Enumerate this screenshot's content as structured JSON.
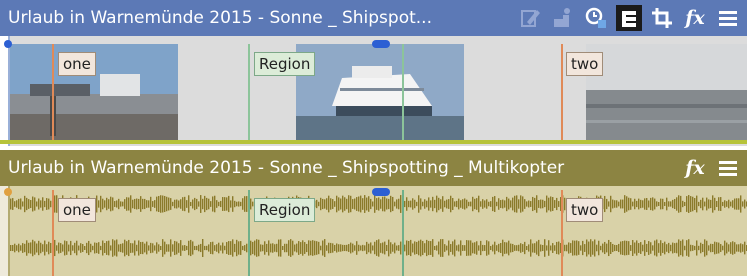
{
  "video_track": {
    "title": "Urlaub in Warnemünde 2015 - Sonne _ Shipspot...",
    "header_color": "#5c79b6",
    "icons": [
      "edit-media-icon",
      "pan-crop-icon",
      "event-fx-icon",
      "compositing-icon",
      "crop-icon",
      "fx-icon",
      "menu-icon"
    ],
    "fx_label": "fx",
    "markers": [
      {
        "label": "one",
        "type": "marker"
      },
      {
        "label": "Region",
        "type": "region"
      },
      {
        "label": "two",
        "type": "marker"
      }
    ]
  },
  "audio_track": {
    "title": "Urlaub in Warnemünde 2015 - Sonne _ Shipspotting _ Multikopter",
    "header_color": "#8c8442",
    "fx_label": "fx",
    "markers": [
      {
        "label": "one",
        "type": "marker"
      },
      {
        "label": "Region",
        "type": "region"
      },
      {
        "label": "two",
        "type": "marker"
      }
    ]
  }
}
